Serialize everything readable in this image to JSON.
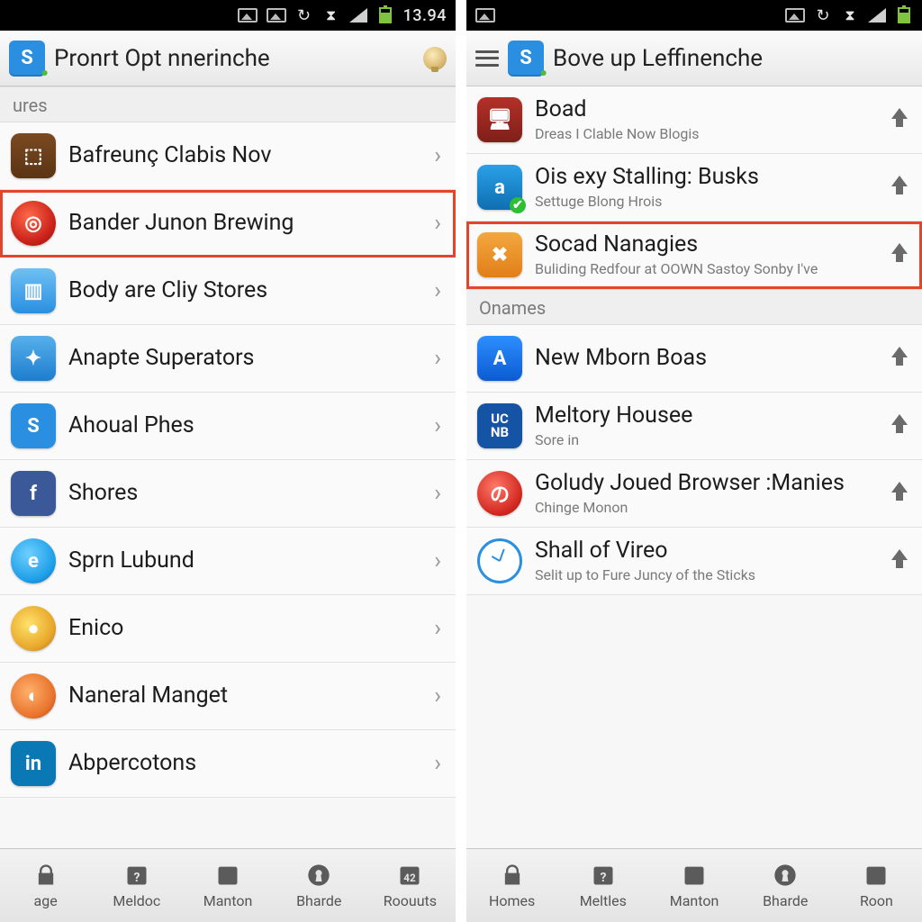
{
  "left": {
    "status": {
      "time": "13.94"
    },
    "header": {
      "title": "Pronrt Opt nnerinche",
      "badge": "S"
    },
    "section": "ures",
    "items": [
      {
        "icon": "ic-brown",
        "glyph": "⬚",
        "title": "Bafreunç Clabis Nov"
      },
      {
        "icon": "ic-red-circle",
        "glyph": "◎",
        "title": "Bander Junon Brewing",
        "highlight": true
      },
      {
        "icon": "ic-lblue",
        "glyph": "▥",
        "title": "Body are Cliy Stores"
      },
      {
        "icon": "ic-lblue2",
        "glyph": "✦",
        "title": "Anapte Superators"
      },
      {
        "icon": "ic-blue-s",
        "glyph": "S",
        "title": "Ahoual Phes"
      },
      {
        "icon": "ic-fb",
        "glyph": "f",
        "title": "Shores"
      },
      {
        "icon": "ic-azure-circle",
        "glyph": "e",
        "title": "Sprn Lubund"
      },
      {
        "icon": "ic-gold-circle",
        "glyph": "●",
        "title": "Enico"
      },
      {
        "icon": "ic-orange-circle",
        "glyph": "◐",
        "title": "Naneral Manget"
      },
      {
        "icon": "ic-linkedin",
        "glyph": "in",
        "title": "Abpercotons"
      }
    ],
    "tabs": [
      {
        "label": "age",
        "icon": "lock"
      },
      {
        "label": "Meldoc",
        "icon": "cal-q"
      },
      {
        "label": "Manton",
        "icon": "cal"
      },
      {
        "label": "Bharde",
        "icon": "keyhole"
      },
      {
        "label": "Roouuts",
        "icon": "cal-42",
        "badge": "42"
      }
    ]
  },
  "right": {
    "status": {
      "time": ""
    },
    "header": {
      "title": "Bove up Leffinenche",
      "badge": "S"
    },
    "items_top": [
      {
        "icon": "ic-darkred",
        "glyph": "🖥",
        "title": "Boad",
        "sub": "Dreas I Clable Now Blogis"
      },
      {
        "icon": "ic-a",
        "glyph": "a",
        "title": "Ois exy Stalling: Busks",
        "sub": "Settuge Blong Hrois"
      },
      {
        "icon": "ic-orange-book",
        "glyph": "✖",
        "title": "Socad Nanagies",
        "sub": "Buliding Redfour at OOWN Sastoy Sonby I've",
        "highlight": true
      }
    ],
    "section": "Onames",
    "items_bottom": [
      {
        "icon": "ic-appstore",
        "glyph": "A",
        "title": "New Mborn Boas"
      },
      {
        "icon": "ic-uc",
        "glyph": "UC\nNB",
        "title": "Meltory Housee",
        "sub": "Sore in"
      },
      {
        "icon": "ic-red-swirl",
        "glyph": "の",
        "title": "Goludy Joued Browser :Manies",
        "sub": "Chinge Monon"
      },
      {
        "icon": "ic-clock",
        "glyph": "",
        "title": "Shall of Vireo",
        "sub": "Selit up to Fure Juncy of the Sticks"
      }
    ],
    "tabs": [
      {
        "label": "Homes",
        "icon": "lock"
      },
      {
        "label": "Meltles",
        "icon": "cal-q"
      },
      {
        "label": "Manton",
        "icon": "cal"
      },
      {
        "label": "Bharde",
        "icon": "keyhole"
      },
      {
        "label": "Roon",
        "icon": "cal"
      }
    ]
  }
}
